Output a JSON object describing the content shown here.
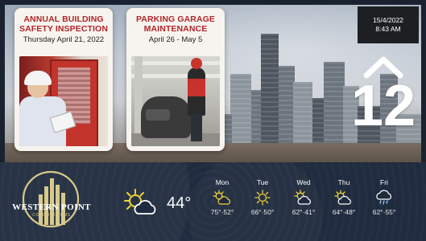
{
  "events": [
    {
      "title": "ANNUAL BUILDING SAFETY INSPECTION",
      "date": "Thursday April 21, 2022"
    },
    {
      "title": "PARKING GARAGE MAINTENANCE",
      "date": "April 26 - May 5"
    }
  ],
  "datetime": {
    "date": "15/4/2022",
    "time": "8:43 AM"
  },
  "elevator": {
    "floor": "12",
    "direction": "up"
  },
  "brand": {
    "name": "WESTERN POINT",
    "subtitle": "CONDOMINIUMS"
  },
  "weather": {
    "current": {
      "temp": "44°",
      "icon": "sun-cloud-icon"
    },
    "forecast": [
      {
        "day": "Mon",
        "icon": "partly-sunny-icon",
        "temps": "75°·52°"
      },
      {
        "day": "Tue",
        "icon": "sun-icon",
        "temps": "66°·50°"
      },
      {
        "day": "Wed",
        "icon": "partly-cloudy-icon",
        "temps": "62°·41°"
      },
      {
        "day": "Thu",
        "icon": "partly-cloudy-icon",
        "temps": "64°·48°"
      },
      {
        "day": "Fri",
        "icon": "rain-cloud-icon",
        "temps": "62°·55°"
      }
    ]
  },
  "colors": {
    "accent_red": "#b2252a",
    "gold": "#d8c98a",
    "panel": "#1f2b3e"
  }
}
